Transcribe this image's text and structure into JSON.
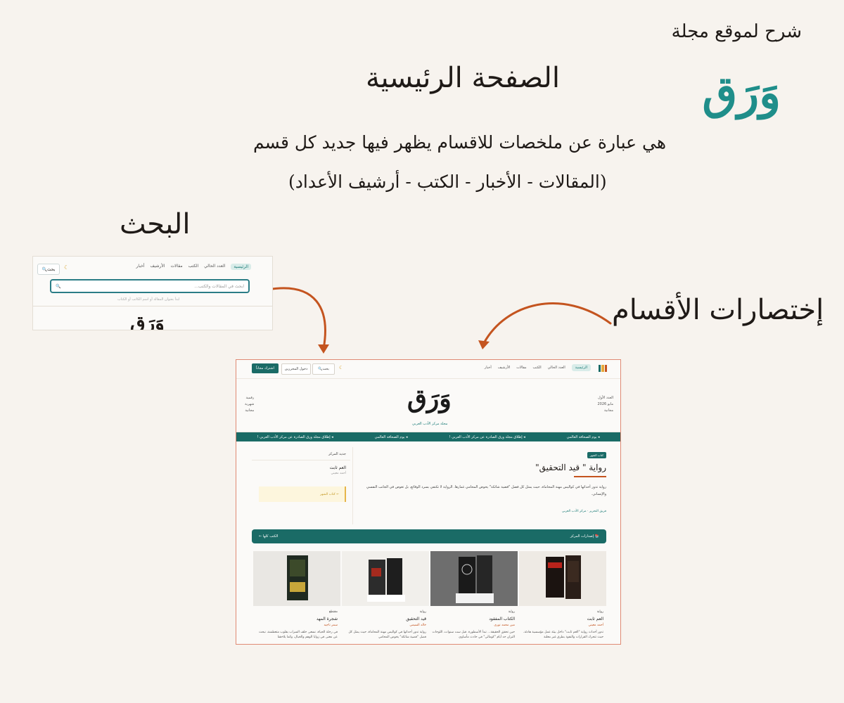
{
  "slide": {
    "intro": "شرح لموقع مجلة",
    "brand": "وَرَق",
    "heading": "الصفحة الرئيسية",
    "description_line1": "هي عبارة عن ملخصات للاقسام يظهر فيها جديد كل قسم",
    "description_line2": "(المقالات - الأخبار - الكتب - أرشيف الأعداد)",
    "label_search": "البحث",
    "label_shortcuts": "إختصارات الأقسام",
    "arrow_color": "#c4541f"
  },
  "search_crop": {
    "search_button": "بحث",
    "nav_items": [
      "الرئيسية",
      "العدد الحالي",
      "الكتب",
      "مقالات",
      "الأرشيف",
      "أخبار"
    ],
    "placeholder": "ابحث في المقالات والكتب...",
    "hint": "ابدأ بعنوان المقالة أو اسم الكاتب أو الكتاب",
    "logo": "وَرَق"
  },
  "site": {
    "nav": {
      "items": [
        "الرئيسية",
        "العدد الحالي",
        "الكتب",
        "مقالات",
        "الأرشيف",
        "أخبار"
      ],
      "search_button": "بحث",
      "login_button": "دخول المحررين",
      "subscribe_button": "اشترك مجاناً"
    },
    "masthead": {
      "logo": "وَرَق",
      "tagline": "مجلة مركز الأدب العربي",
      "issue": "العدد الأول",
      "date": "مايو 2026",
      "price": "مجانية",
      "type1": "رقمية",
      "type2": "شهرية",
      "type3": "مجانية"
    },
    "ticker": [
      "إطلاق مجلة ورق الصادرة عن مركز الأدب العربي !",
      "يوم الصحافة العالمي",
      "إطلاق مجلة ورق الصادرة عن مركز الأدب العربي !",
      "يوم الصحافة العالمي"
    ],
    "feature": {
      "badge": "كتاب الشهر",
      "title": "رواية \" قيد التحقيق\"",
      "text": "رواية تدور أحداثها في كواليس مهنة المحاماة، حيث يمثل كل فصل \"قضية شائكة\" يخوض المحامي غمارها. الرواية لا تكتفي بسرد الوقائع، بل تغوص في الجانب النفسي والإنساني.",
      "author": "فريق التحرير · مركز الأدب العربي"
    },
    "sidebar": {
      "heading": "جديد المركز",
      "book_title": "العم ثابت",
      "book_author": "أحمد معيني",
      "more": "← كتاب الشهر"
    },
    "releases": {
      "title": "إصدارات المركز",
      "all_link": "الكتب كلها ←"
    },
    "books": [
      {
        "type": "رواية",
        "title": "العم ثابت",
        "author": "أحمد معيني",
        "desc": "تدور أحداث رواية \"العم ثابت\" داخل بيئة عمل مؤسسية هادئة، حيث تتحرك القرارات والنفوذ بطرق غير معلنة"
      },
      {
        "type": "رواية",
        "title": "الكتاب المفقود",
        "author": "مين محمد نوري",
        "desc": "حين تحقق الحقيقة... تبدأ الأسطورة. قبل ست سنوات، اللوحات التزان حد أيام \"كومالي\" في حادث مأساوي"
      },
      {
        "type": "رواية",
        "title": "قيد التحقيق",
        "author": "خالد السيمي",
        "desc": "رواية تدور أحداثها في كواليس مهنة المحاماة، حيث يمثل كل فصل \"قضية شائكة\" يخوض المحامي"
      },
      {
        "type": "مقتطع",
        "title": "شجرة المهد",
        "author": "سمر ناجيه",
        "desc": "في رحلة الحياة، نسعى خلف السراب بقلوب متعطشة، نبحث عن معنى في زوايا الوهم والخيال، وكما يلاحقنا"
      }
    ]
  }
}
